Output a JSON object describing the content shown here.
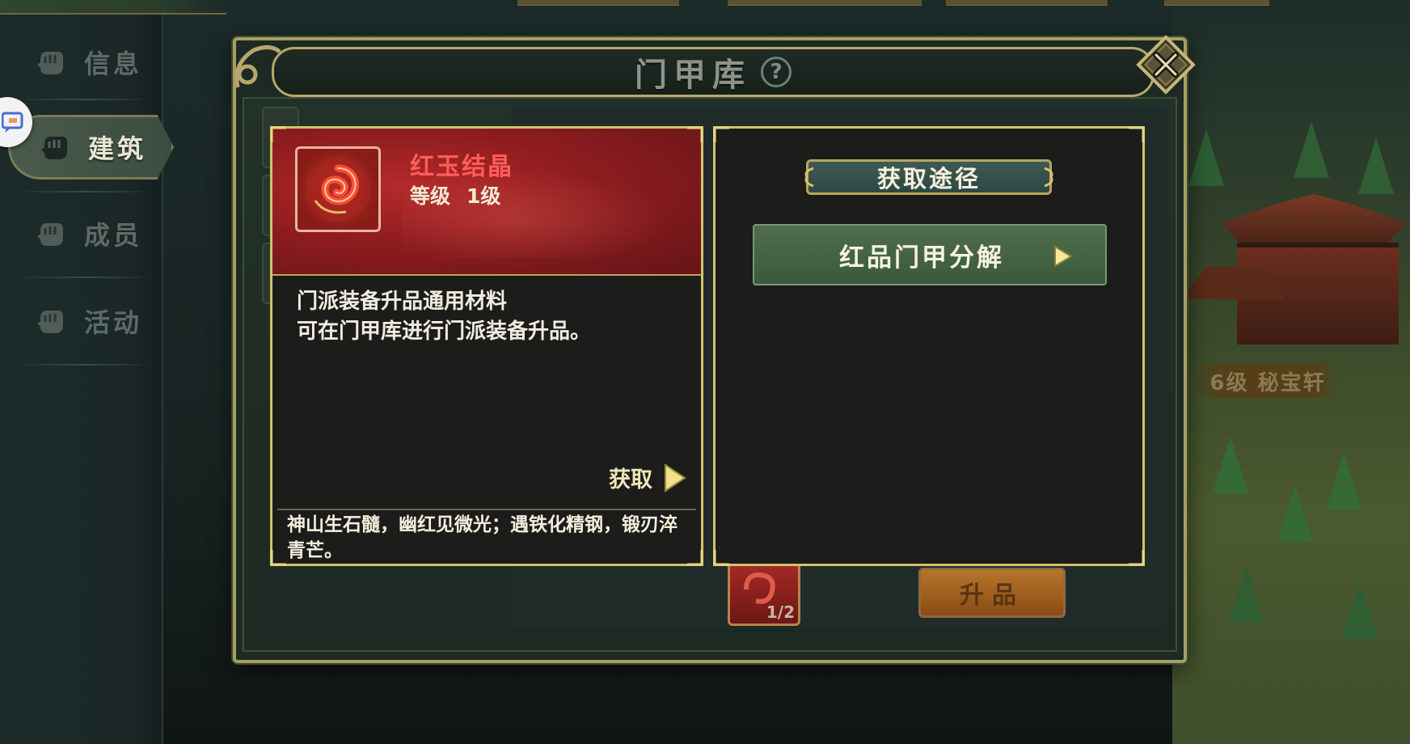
{
  "sidebar": {
    "items": [
      {
        "label": "信息"
      },
      {
        "label": "建筑"
      },
      {
        "label": "成员"
      },
      {
        "label": "活动"
      }
    ],
    "active_index": 1
  },
  "scenery": {
    "building_label": "6级 秘宝轩"
  },
  "panel": {
    "title": "门甲库",
    "help_icon": "question-mark-icon",
    "close_icon": "close-x-icon"
  },
  "item": {
    "name": "红玉结晶",
    "level_label": "等级",
    "level_value": "1级",
    "description_lines": [
      "门派装备升品通用材料",
      "可在门甲库进行门派装备升品。"
    ],
    "acquire_label": "获取",
    "flavor_text": "神山生石髓，幽红见微光；遇铁化精钢，锻刃淬青芒。",
    "name_color": "#ff5d5a"
  },
  "routes": {
    "title": "获取途径",
    "items": [
      {
        "label": "红品门甲分解"
      }
    ]
  },
  "background": {
    "material_count": "1/2",
    "upgrade_label": "升品"
  }
}
